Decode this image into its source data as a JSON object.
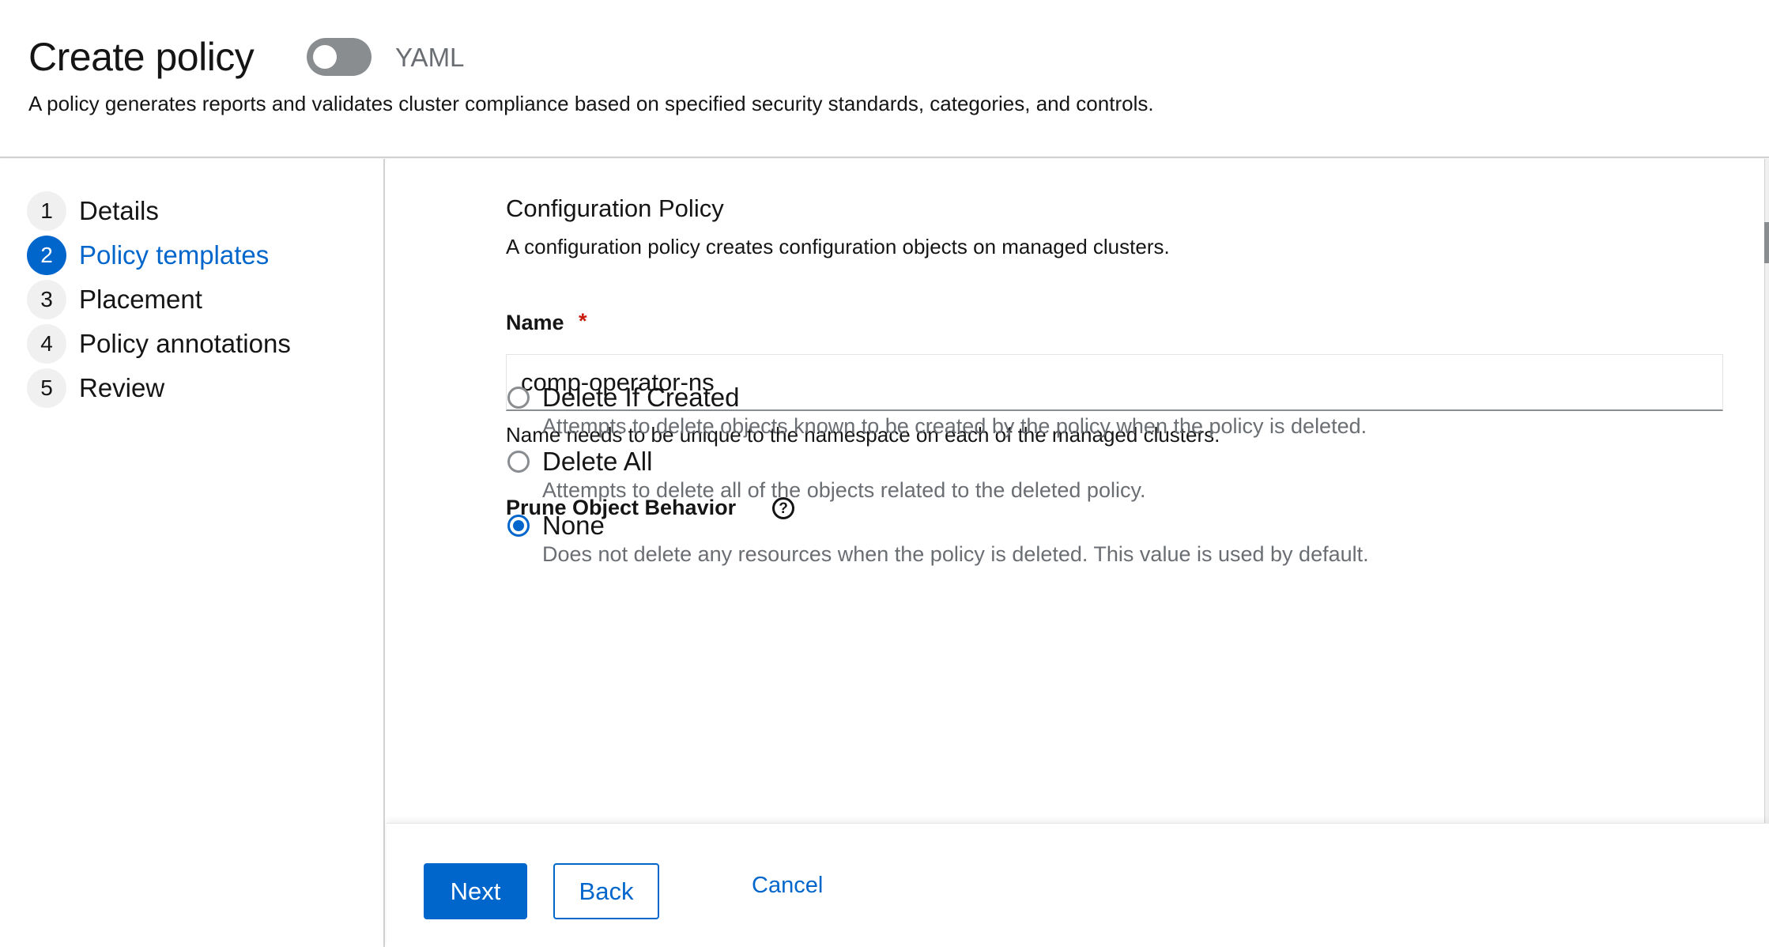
{
  "header": {
    "title": "Create policy",
    "yaml_toggle_label": "YAML",
    "yaml_toggle_on": false,
    "description": "A policy generates reports and validates cluster compliance based on specified security standards, categories, and controls."
  },
  "steps": [
    {
      "number": "1",
      "label": "Details",
      "active": false
    },
    {
      "number": "2",
      "label": "Policy templates",
      "active": true
    },
    {
      "number": "3",
      "label": "Placement",
      "active": false
    },
    {
      "number": "4",
      "label": "Policy annotations",
      "active": false
    },
    {
      "number": "5",
      "label": "Review",
      "active": false
    }
  ],
  "main": {
    "section_title": "Configuration Policy",
    "section_description": "A configuration policy creates configuration objects on managed clusters.",
    "name_field": {
      "label": "Name",
      "required_marker": "*",
      "value": "comp-operator-ns",
      "helper_text": "Name needs to be unique to the namespace on each of the managed clusters."
    },
    "prune": {
      "label": "Prune Object Behavior",
      "help_icon": "help-circle-icon",
      "help_glyph": "?",
      "options": [
        {
          "label": "Delete If Created",
          "description": "Attempts to delete objects known to be created by the policy when the policy is deleted.",
          "checked": false
        },
        {
          "label": "Delete All",
          "description": "Attempts to delete all of the objects related to the deleted policy.",
          "checked": false
        },
        {
          "label": "None",
          "description": "Does not delete any resources when the policy is deleted. This value is used by default.",
          "checked": true
        }
      ]
    }
  },
  "footer": {
    "next_label": "Next",
    "back_label": "Back",
    "cancel_label": "Cancel"
  },
  "colors": {
    "accent": "#0066cc",
    "required": "#c9190b",
    "muted_text": "#6a6e73"
  }
}
